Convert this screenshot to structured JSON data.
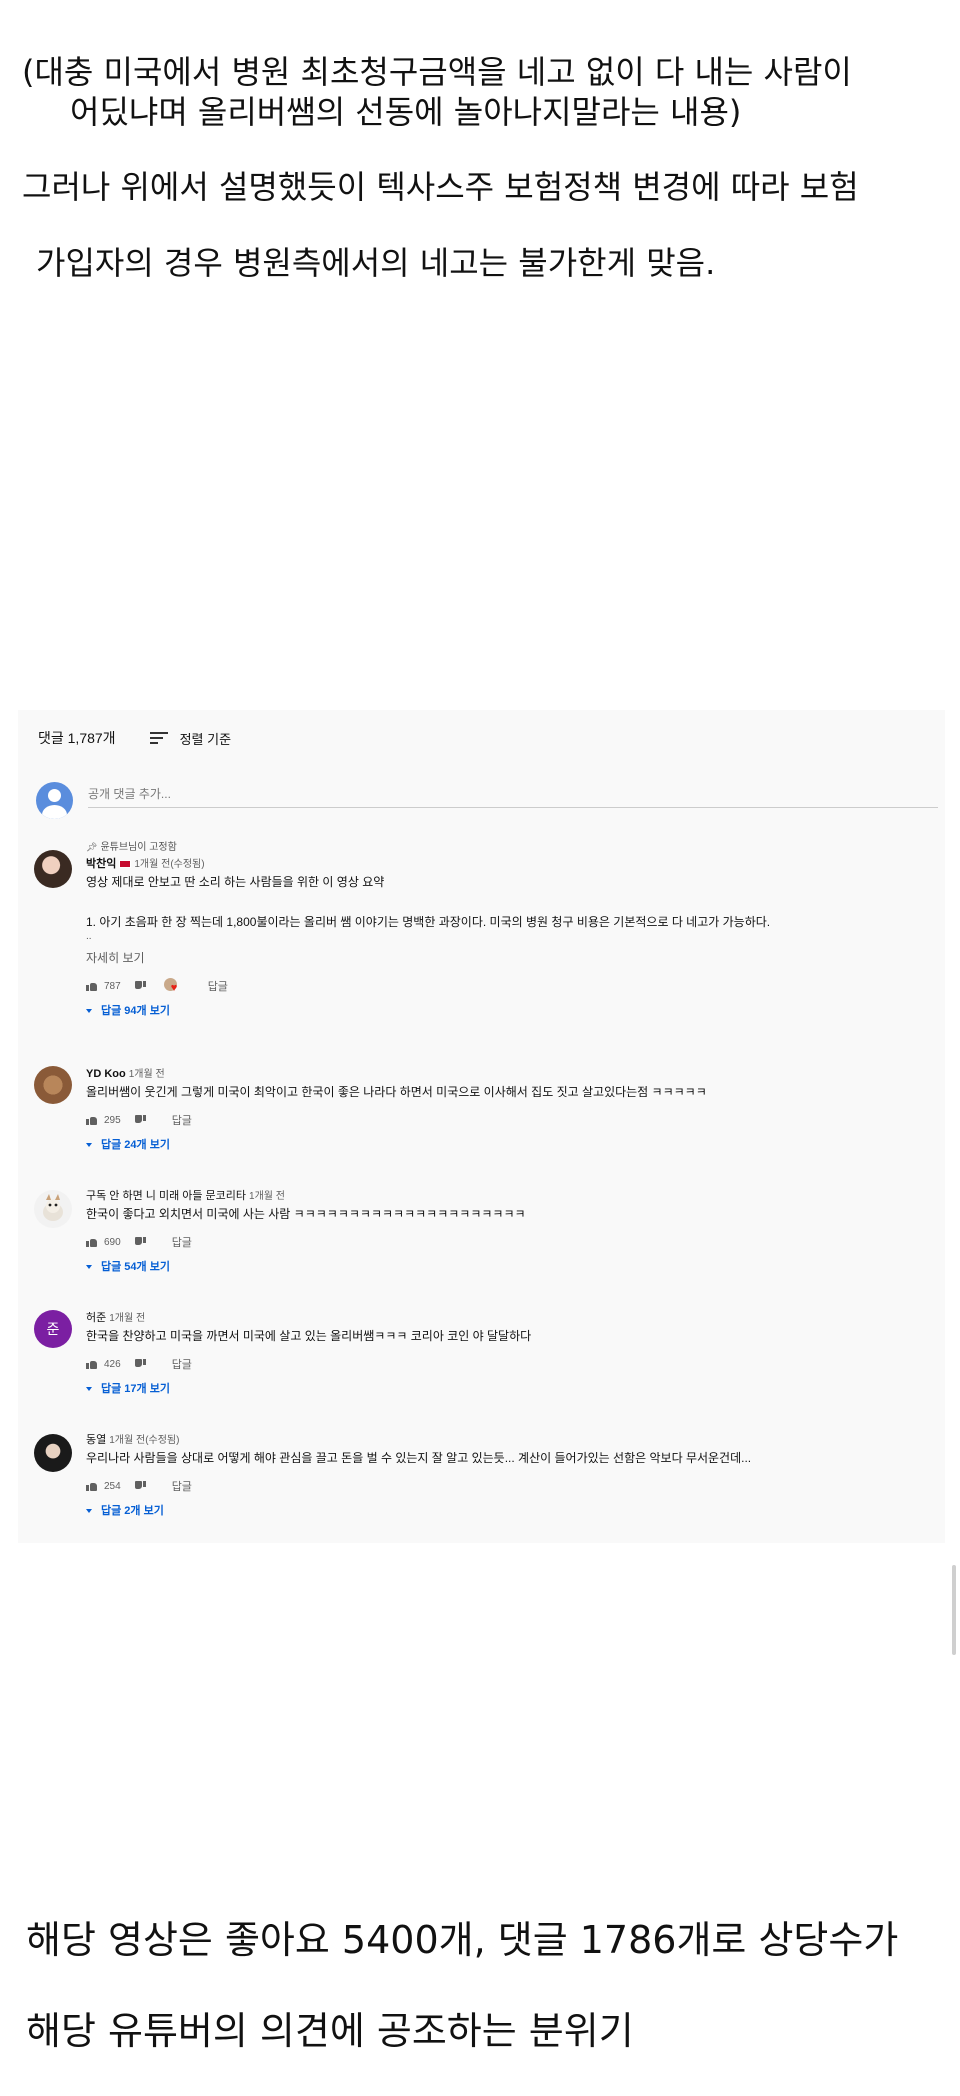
{
  "article": {
    "line1": "(대충 미국에서 병원 최초청구금액을 네고 없이 다 내는 사람이",
    "line1b": "어딨냐며 올리버쌤의 선동에 놀아나지말라는 내용)",
    "line2": "그러나 위에서 설명했듯이 텍사스주 보험정책 변경에 따라 보험",
    "line3": "가입자의 경우 병원측에서의 네고는 불가한게 맞음.",
    "bottom1": "해당 영상은 좋아요 5400개, 댓글 1786개로 상당수가",
    "bottom2": "해당 유튜버의 의견에 공조하는 분위기"
  },
  "youtube": {
    "comment_count": "댓글 1,787개",
    "sort_label": "정렬 기준",
    "add_comment_placeholder": "공개 댓글 추가...",
    "reply_label": "답글",
    "comments": [
      {
        "pinned": "윤튜브님이 고정함",
        "author": "박찬익",
        "time": "1개월 전(수정됨)",
        "text_lines": [
          "영상 제대로 안보고 딴 소리 하는 사람들을 위한 이 영상 요약",
          "",
          "1. 아기 초음파 한 장 찍는데 1,800불이라는 올리버 쌤 이야기는 명백한 과장이다. 미국의 병원 청구 비용은 기본적으로 다 네고가 가능하다."
        ],
        "ellipsis": "..",
        "more": "자세히 보기",
        "likes": "787",
        "replies": "답글 94개 보기"
      },
      {
        "author": "YD Koo",
        "time": "1개월 전",
        "text": "올리버쌤이 웃긴게 그렇게 미국이 최악이고 한국이 좋은 나라다 하면서 미국으로 이사해서 집도 짓고 살고있다는점 ㅋㅋㅋㅋㅋ",
        "likes": "295",
        "replies": "답글 24개 보기"
      },
      {
        "author": "구독 안 하면 니 미래 아들 문코리타",
        "time": "1개월 전",
        "text": "한국이 좋다고 외치면서 미국에 사는 사람 ㅋㅋㅋㅋㅋㅋㅋㅋㅋㅋㅋㅋㅋㅋㅋㅋㅋㅋㅋㅋㅋ",
        "likes": "690",
        "replies": "답글 54개 보기"
      },
      {
        "author": "허준",
        "avatar_initial": "준",
        "time": "1개월 전",
        "text": "한국을 찬양하고 미국을 까면서 미국에 살고 있는 올리버쌤ㅋㅋㅋ 코리아 코인 야 달달하다",
        "likes": "426",
        "replies": "답글 17개 보기"
      },
      {
        "author": "동열",
        "time": "1개월 전(수정됨)",
        "text": "우리나라 사람들을 상대로 어떻게 해야 관심을 끌고 돈을 벌 수 있는지 잘 알고 있는듯... 계산이 들어가있는 선함은 악보다 무서운건데...",
        "likes": "254",
        "replies": "답글 2개 보기"
      }
    ]
  },
  "colors": {
    "link_blue": "#065fd4",
    "panel_bg": "#f9f9f9",
    "avatar_purple": "#7b1fa2",
    "heart_red": "#e62117"
  }
}
